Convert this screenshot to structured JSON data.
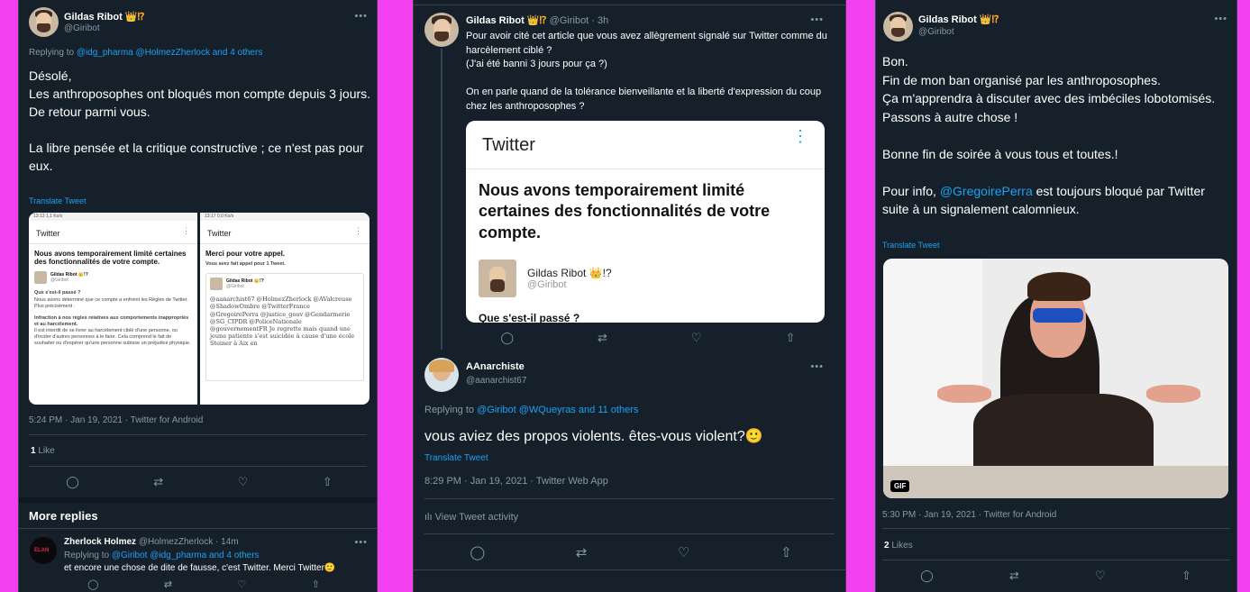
{
  "panel1": {
    "author_name": "Gildas Ribot",
    "author_badge": "👑⁉",
    "author_handle": "@Giribot",
    "more": "•••",
    "replying_prefix": "Replying to",
    "replying_links": "@idg_pharma @HolmezZherlock and 4 others",
    "tweet_text": "Désolé,\nLes anthroposophes ont bloqués mon compte depuis 3 jours.\nDe retour parmi vous.\n\nLa libre pensée et la critique constructive ; ce n'est pas pour eux.",
    "translate": "Translate Tweet",
    "screenshot_left": {
      "status": "13:13  1,1 Ko/s",
      "header": "Twitter",
      "title": "Nous avons temporairement limité certaines des fonctionnalités de votre compte.",
      "user": "Gildas Ribot 👑!?",
      "user_handle": "@Giribot",
      "q": "Que s'est-il passé ?",
      "body": "Nous avons déterminé que ce compte a enfreint les Règles de Twitter. Plus précisément :",
      "rule": "Infraction à nos règles relatives aux comportements inappropriés et au harcèlement.",
      "rule_detail": "Il est interdit de se livrer au harcèlement ciblé d'une personne, ou d'inciter d'autres personnes à le faire. Cela comprend le fait de souhaiter ou d'espérer qu'une personne subisse un préjudice physique."
    },
    "screenshot_right": {
      "status": "13:17  0,0 Ko/s",
      "header": "Twitter",
      "title": "Merci pour votre appel.",
      "sub": "Vous avez fait appel pour 1 Tweet.",
      "user": "Gildas Ribot 👑!?",
      "user_handle": "@Giribot",
      "quoted": "@aanarchist67 @HolmezZherlock @AValcreuse @ShadowOmbre @TwitterFrance @GregoirePerra @justice_gouv @Gendarmerie @SG_CIPDR @PoliceNationale @gouvernementFR Je regrette mais quand une jeune patiente s'est suicidée à cause d'une école Steiner à Aix en"
    },
    "timestamp": "5:24 PM · Jan 19, 2021 · Twitter for Android",
    "likes_count": "1",
    "likes_label": "Like",
    "more_replies": "More replies",
    "reply": {
      "name": "Zherlock Holmez",
      "handle": "@HolmezZherlock · 14m",
      "replying_prefix": "Replying to",
      "replying_links": "@Giribot @idg_pharma and 4 others",
      "text": "et encore une chose de dite de fausse, c'est Twitter. Merci Twitter🙂"
    }
  },
  "panel2": {
    "author_name": "Gildas Ribot",
    "author_badge": "👑⁉",
    "author_handle": "@Giribot · 3h",
    "more": "•••",
    "tweet_text": "Pour avoir cité cet article que vous avez allègrement signalé sur Twitter comme du harcèlement ciblé ?\n(J'ai été banni 3 jours pour ça ?)\n\nOn en parle quand de la tolérance bienveillante et la liberté d'expression du coup chez les anthroposophes ?",
    "card": {
      "header": "Twitter",
      "title": "Nous avons temporairement limité certaines des fonctionnalités de votre compte.",
      "user": "Gildas Ribot 👑!?",
      "user_handle": "@Giribot",
      "cut_text": "Que s'est-il passé ?"
    },
    "reply": {
      "name": "AAnarchiste",
      "handle": "@aanarchist67",
      "more": "•••",
      "replying_prefix": "Replying to",
      "replying_links": "@Giribot @WQueyras and 11 others",
      "text": "vous aviez des propos violents. êtes-vous violent?🙂",
      "translate": "Translate Tweet",
      "timestamp": "8:29 PM · Jan 19, 2021 · Twitter Web App",
      "activity": "View Tweet activity"
    }
  },
  "panel3": {
    "author_name": "Gildas Ribot",
    "author_badge": "👑⁉",
    "author_handle": "@Giribot",
    "more": "•••",
    "tweet_line1": "Bon.\nFin de mon ban organisé par les anthroposophes.\nÇa m'apprendra à discuter avec des imbéciles lobotomisés.\nPassons à autre chose !\n\nBonne fin de soirée à vous tous et toutes.!\n\nPour info, ",
    "tweet_mention": "@GregoirePerra",
    "tweet_line2": " est toujours bloqué par Twitter suite à un signalement calomnieux.",
    "translate": "Translate Tweet",
    "gif_badge": "GIF",
    "timestamp": "5:30 PM · Jan 19, 2021 · Twitter for Android",
    "likes_count": "2",
    "likes_label": "Likes"
  },
  "icons": [
    "reply-icon",
    "retweet-icon",
    "like-icon",
    "share-icon",
    "activity-icon",
    "gif-badge"
  ],
  "colors": {
    "background": "#15202b",
    "accent": "#1da1f2",
    "muted": "#8899a6",
    "frame": "#f23ff0"
  }
}
